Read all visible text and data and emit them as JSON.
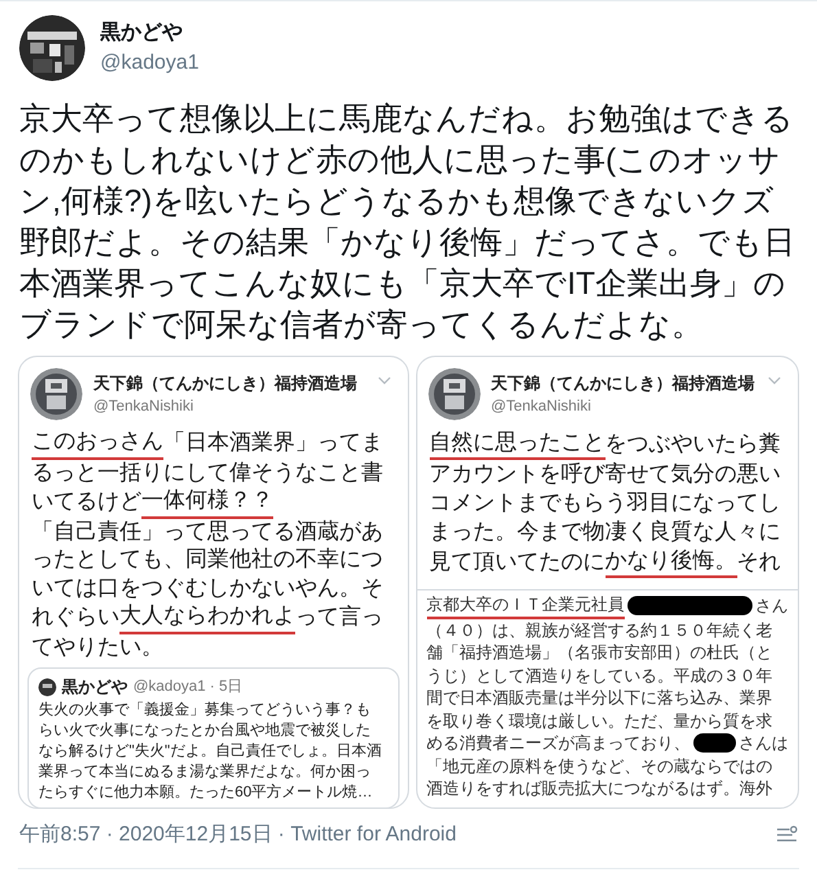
{
  "tweet": {
    "author": {
      "name": "黒かどや",
      "handle": "@kadoya1"
    },
    "text": "京大卒って想像以上に馬鹿なんだね。お勉強はできるのかもしれないけど赤の他人に思った事(このオッサン,何様?)を呟いたらどうなるかも想像できないクズ野郎だよ。その結果「かなり後悔」だってさ。でも日本酒業界ってこんな奴にも「京大卒でIT企業出身」のブランドで阿呆な信者が寄ってくるんだよな。",
    "image": {
      "panels": [
        {
          "name": "天下錦（てんかにしき）福持酒造場",
          "handle": "@TenkaNishiki",
          "lines": [
            [
              {
                "kind": "text",
                "text": "このおっさん",
                "underlined": true
              },
              {
                "kind": "text",
                "text": "「日本酒業界」ってま",
                "underlined": false
              }
            ],
            [
              {
                "kind": "text",
                "text": "るっと一括りにして偉そうなこと書",
                "underlined": false
              }
            ],
            [
              {
                "kind": "text",
                "text": "いてるけど",
                "underlined": false
              },
              {
                "kind": "text",
                "text": "一体何様？？",
                "underlined": true
              }
            ],
            [
              {
                "kind": "text",
                "text": "「自己責任」って思ってる酒蔵があ",
                "underlined": false
              }
            ],
            [
              {
                "kind": "text",
                "text": "ったとしても、同業他社の不幸につ",
                "underlined": false
              }
            ],
            [
              {
                "kind": "text",
                "text": "いては口をつぐむしかないやん。そ",
                "underlined": false
              }
            ],
            [
              {
                "kind": "text",
                "text": "れぐらい",
                "underlined": false
              },
              {
                "kind": "text",
                "text": "大人ならわかれよ",
                "underlined": true
              },
              {
                "kind": "text",
                "text": "って言っ",
                "underlined": false
              }
            ],
            [
              {
                "kind": "text",
                "text": "てやりたい。",
                "underlined": false
              }
            ]
          ],
          "quote": {
            "name": "黒かどや",
            "meta": "@kadoya1 · 5日",
            "lines": [
              "失火の火事で「義援金」募集ってどういう事？も",
              "らい火で火事になったとか台風や地震で被災した",
              "なら解るけど\"失火\"だよ。自己責任でしょ。日本酒",
              "業界って本当にぬるま湯な業界だよな。何か困っ",
              "たらすぐに他力本願。たった60平方メートル焼…"
            ]
          }
        },
        {
          "name": "天下錦（てんかにしき）福持酒造場",
          "handle": "@TenkaNishiki",
          "lines": [
            [
              {
                "kind": "text",
                "text": "自然に思ったこと",
                "underlined": true
              },
              {
                "kind": "text",
                "text": "をつぶやいたら糞",
                "underlined": false
              }
            ],
            [
              {
                "kind": "text",
                "text": "アカウントを呼び寄せて気分の悪い",
                "underlined": false
              }
            ],
            [
              {
                "kind": "text",
                "text": "コメントまでもらう羽目になってし",
                "underlined": false
              }
            ],
            [
              {
                "kind": "text",
                "text": "まった。今まで物凄く良質な人々に",
                "underlined": false
              }
            ],
            [
              {
                "kind": "text",
                "text": "見て頂いてたのに",
                "underlined": false
              },
              {
                "kind": "text",
                "text": "かなり後悔。",
                "underlined": true
              },
              {
                "kind": "text",
                "text": "それ",
                "underlined": false
              }
            ]
          ],
          "article": {
            "lines": [
              [
                {
                  "kind": "text",
                  "text": "京都大卒のＩＴ企業元社員",
                  "underlined": true
                },
                {
                  "kind": "redaction"
                },
                {
                  "kind": "text",
                  "text": "さん",
                  "underlined": false
                }
              ],
              [
                {
                  "kind": "text",
                  "text": "（４０）は、親族が経営する約１５０年続く老",
                  "underlined": false
                }
              ],
              [
                {
                  "kind": "text",
                  "text": "舗「福持酒造場」（名張市安部田）の杜氏（と",
                  "underlined": false
                }
              ],
              [
                {
                  "kind": "text",
                  "text": "うじ）として酒造りをしている。平成の３０年",
                  "underlined": false
                }
              ],
              [
                {
                  "kind": "text",
                  "text": "間で日本酒販売量は半分以下に落ち込み、業界",
                  "underlined": false
                }
              ],
              [
                {
                  "kind": "text",
                  "text": "を取り巻く環境は厳しい。ただ、量から質を求",
                  "underlined": false
                }
              ],
              [
                {
                  "kind": "text",
                  "text": "める消費者ニーズが高まっており、",
                  "underlined": false
                },
                {
                  "kind": "redaction"
                },
                {
                  "kind": "text",
                  "text": "さんは",
                  "underlined": false
                }
              ],
              [
                {
                  "kind": "text",
                  "text": "「地元産の原料を使うなど、その蔵ならではの",
                  "underlined": false
                }
              ],
              [
                {
                  "kind": "text",
                  "text": "酒造りをすれば販売拡大につながるはず。海外",
                  "underlined": false
                }
              ]
            ]
          }
        }
      ]
    },
    "meta": "午前8:57 · 2020年12月15日 · Twitter for Android"
  }
}
